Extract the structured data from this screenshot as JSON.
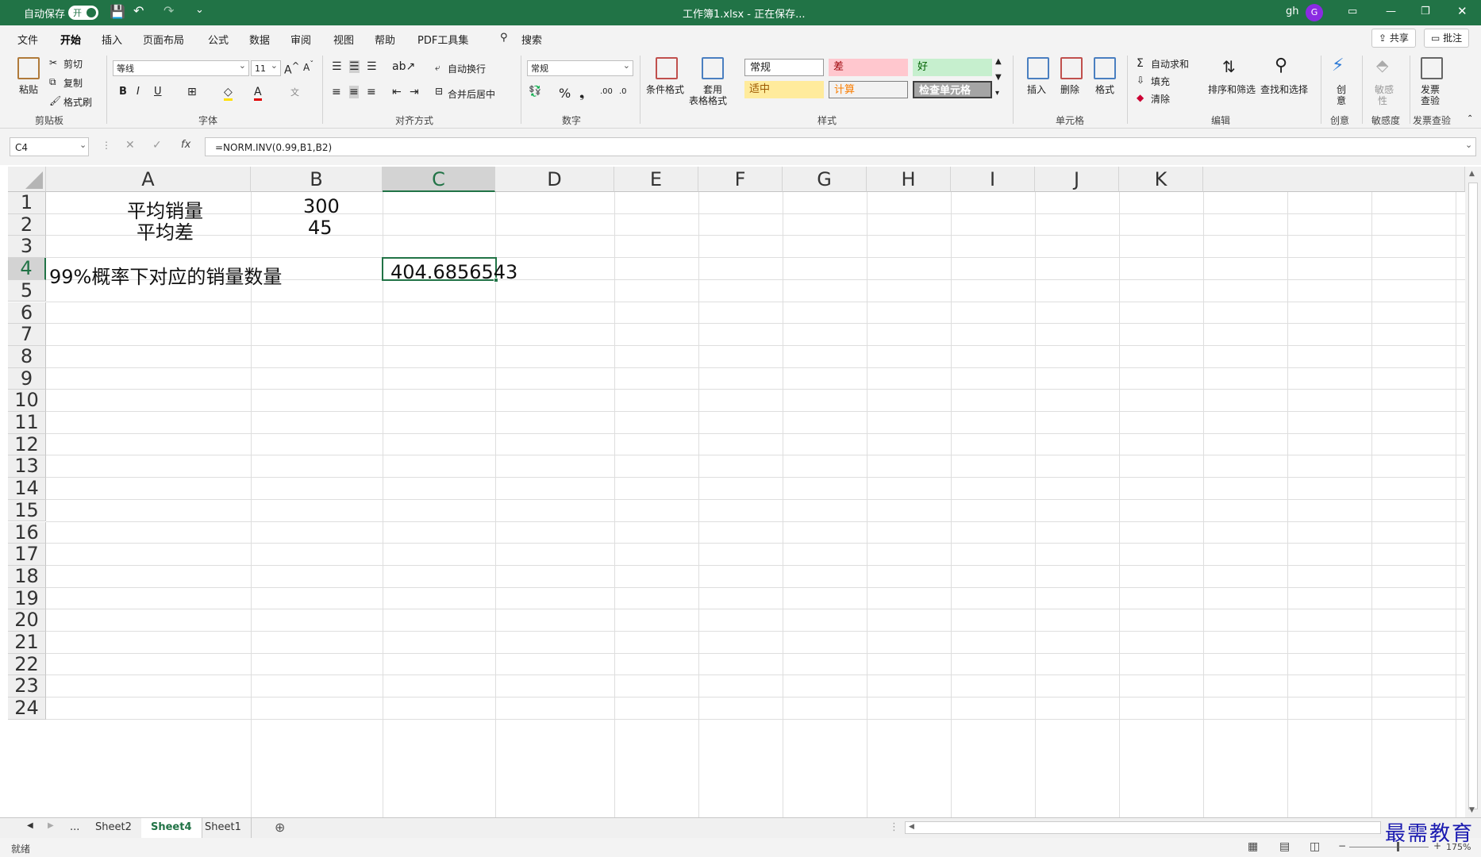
{
  "title_bar": {
    "autosave_label": "自动保存",
    "autosave_state": "开",
    "doc_title": "工作簿1.xlsx - 正在保存...",
    "user_name": "gh",
    "avatar_initial": "G"
  },
  "menu": {
    "tabs": [
      "文件",
      "开始",
      "插入",
      "页面布局",
      "公式",
      "数据",
      "审阅",
      "视图",
      "帮助",
      "PDF工具集"
    ],
    "active_tab": "开始",
    "search_label": "搜索",
    "share_label": "共享",
    "comments_label": "批注"
  },
  "ribbon": {
    "clipboard": {
      "paste": "粘贴",
      "cut": "剪切",
      "copy": "复制",
      "format_painter": "格式刷",
      "group": "剪贴板"
    },
    "font": {
      "font_name": "等线",
      "font_size": "11",
      "group": "字体"
    },
    "alignment": {
      "wrap_text": "自动换行",
      "merge_center": "合并后居中",
      "group": "对齐方式"
    },
    "number": {
      "format": "常规",
      "group": "数字"
    },
    "styles": {
      "conditional_format": "条件格式",
      "table_format_1": "套用",
      "table_format_2": "表格格式",
      "normal": "常规",
      "bad": "差",
      "good": "好",
      "neutral": "适中",
      "calculation": "计算",
      "check_cell": "检查单元格",
      "group": "样式"
    },
    "cells": {
      "insert": "插入",
      "delete": "删除",
      "format": "格式",
      "group": "单元格"
    },
    "editing": {
      "autosum": "自动求和",
      "fill": "填充",
      "clear": "清除",
      "sort_filter": "排序和筛选",
      "find_select": "查找和选择",
      "group": "编辑"
    },
    "ideas": {
      "label_1": "创",
      "label_2": "意",
      "group": "创意"
    },
    "sensitivity": {
      "label_1": "敏感",
      "label_2": "性",
      "group": "敏感度"
    },
    "invoice": {
      "label_1": "发票",
      "label_2": "查验",
      "group": "发票查验"
    }
  },
  "formula_bar": {
    "name_box": "C4",
    "formula": "=NORM.INV(0.99,B1,B2)"
  },
  "grid": {
    "columns": [
      "A",
      "B",
      "C",
      "D",
      "E",
      "F",
      "G",
      "H",
      "I",
      "J",
      "K"
    ],
    "selected_column": "C",
    "rows": [
      "1",
      "2",
      "3",
      "4",
      "5",
      "6",
      "7",
      "8",
      "9",
      "10",
      "11",
      "12",
      "13",
      "14",
      "15",
      "16",
      "17",
      "18",
      "19",
      "20",
      "21",
      "22",
      "23",
      "24"
    ],
    "selected_row": "4",
    "cells": {
      "A1": "平均销量",
      "B1": "300",
      "A2": "平均差",
      "B2": "45",
      "A4": "99%概率下对应的销量数量",
      "C4": "404.6856543"
    }
  },
  "sheets": {
    "more": "...",
    "tabs": [
      "Sheet2",
      "Sheet4",
      "Sheet1"
    ],
    "active": "Sheet4"
  },
  "status": {
    "ready": "就绪",
    "zoom": "175%"
  },
  "watermark": "最需教育"
}
